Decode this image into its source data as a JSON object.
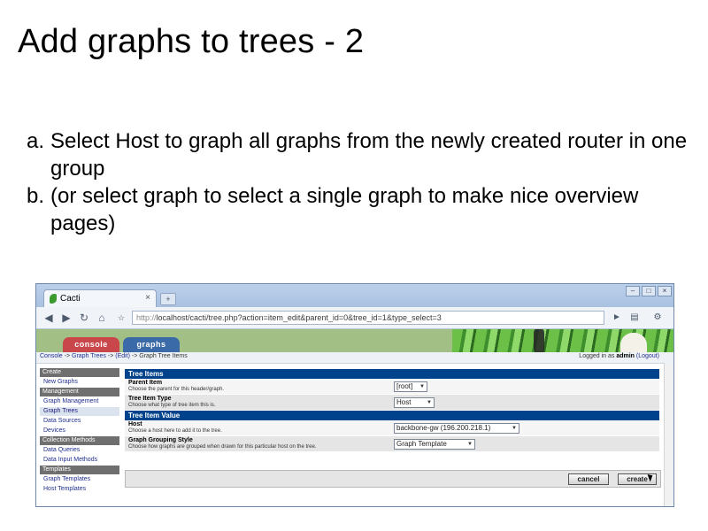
{
  "slide": {
    "title": "Add graphs to trees - 2",
    "bullets": [
      {
        "marker": "a.",
        "text": "Select Host to graph all graphs from the newly created router in one group"
      },
      {
        "marker": "b.",
        "text": "(or select graph to select a single graph to make nice overview pages)"
      }
    ]
  },
  "browser": {
    "tab_title": "Cacti",
    "tab_close": "×",
    "new_tab": "+",
    "url_prefix": "http://",
    "url_rest": "localhost/cacti/tree.php?action=item_edit&parent_id=0&tree_id=1&type_select=3",
    "nav_icons": [
      "back-icon",
      "forward-icon",
      "reload-icon",
      "home-icon"
    ],
    "window_buttons": [
      "minimize-icon",
      "maximize-icon",
      "close-icon"
    ]
  },
  "cacti": {
    "tabs": {
      "console": "console",
      "graphs": "graphs"
    },
    "colors": {
      "console_tab": "#c9464a",
      "graphs_tab": "#3b6aa8",
      "table_header": "#00438c",
      "sidebar_header": "#6f6f6f"
    },
    "breadcrumb": [
      "Console",
      "Graph Trees",
      "(Edit)",
      "Graph Tree Items"
    ],
    "breadcrumb_sep": " -> ",
    "logged_in_prefix": "Logged in as",
    "user": "admin",
    "logout": "(Logout)",
    "sidebar": [
      {
        "type": "header",
        "label": "Create"
      },
      {
        "type": "item",
        "label": "New Graphs"
      },
      {
        "type": "header",
        "label": "Management"
      },
      {
        "type": "item",
        "label": "Graph Management"
      },
      {
        "type": "item",
        "label": "Graph Trees",
        "active": true
      },
      {
        "type": "item",
        "label": "Data Sources"
      },
      {
        "type": "item",
        "label": "Devices"
      },
      {
        "type": "header",
        "label": "Collection Methods"
      },
      {
        "type": "item",
        "label": "Data Queries"
      },
      {
        "type": "item",
        "label": "Data Input Methods"
      },
      {
        "type": "header",
        "label": "Templates"
      },
      {
        "type": "item",
        "label": "Graph Templates"
      },
      {
        "type": "item",
        "label": "Host Templates"
      }
    ],
    "tree_items": {
      "header": "Tree Items",
      "parent_item": {
        "label": "Parent Item",
        "desc": "Choose the parent for this header/graph.",
        "value": "[root]"
      },
      "tree_item_type": {
        "label": "Tree Item Type",
        "desc": "Choose what type of tree item this is.",
        "value": "Host"
      }
    },
    "tree_item_value": {
      "header": "Tree Item Value",
      "host": {
        "label": "Host",
        "desc": "Choose a host here to add it to the tree.",
        "value": "backbone-gw (196.200.218.1)"
      },
      "grouping": {
        "label": "Graph Grouping Style",
        "desc": "Choose how graphs are grouped when drawn for this particular host on the tree.",
        "value": "Graph Template"
      }
    },
    "buttons": {
      "cancel": "cancel",
      "create": "create"
    }
  }
}
